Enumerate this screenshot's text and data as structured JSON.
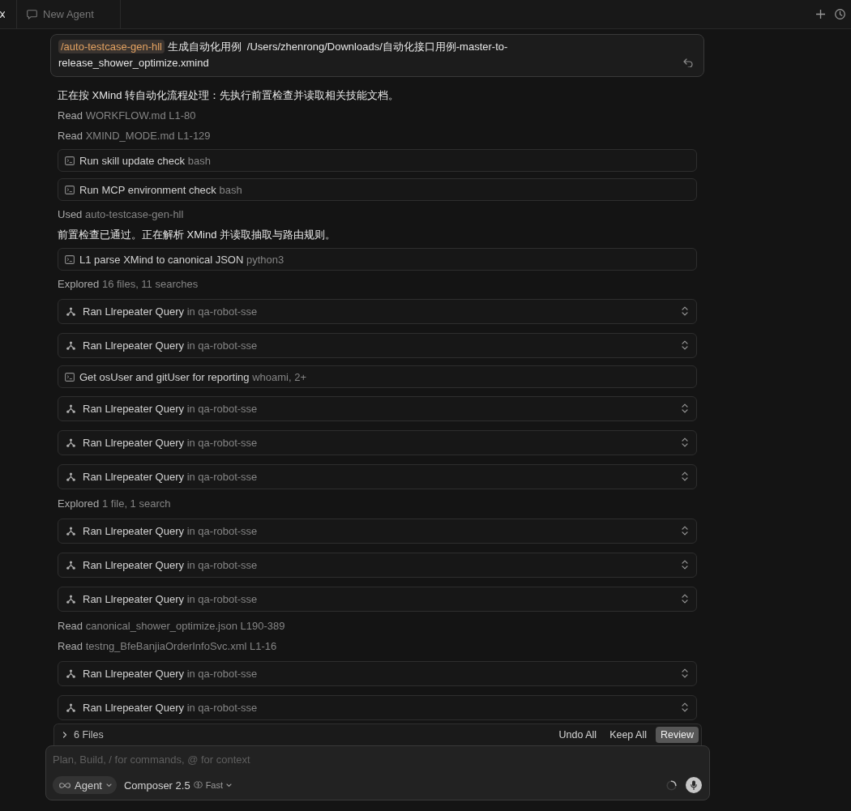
{
  "tab_bar": {
    "tabs": [
      {
        "label": "New Agent",
        "selected": true
      }
    ]
  },
  "user_message": {
    "command": "/auto-testcase-gen-hll",
    "text": "生成自动化用例  /Users/zhenrong/Downloads/自动化接口用例-master-to-release_shower_optimize.xmind"
  },
  "transcript": [
    {
      "kind": "message",
      "text": "正在按 XMind 转自动化流程处理：先执行前置检查并读取相关技能文档。"
    },
    {
      "kind": "action",
      "verb": "Read",
      "detail": "WORKFLOW.md L1-80"
    },
    {
      "kind": "action",
      "verb": "Read",
      "detail": "XMIND_MODE.md L1-129"
    },
    {
      "kind": "command",
      "title": "Run skill update check",
      "detail": "bash"
    },
    {
      "kind": "command",
      "title": "Run MCP environment check",
      "detail": "bash"
    },
    {
      "kind": "action",
      "verb": "Used",
      "detail": "auto-testcase-gen-hll"
    },
    {
      "kind": "message",
      "text": "前置检查已通过。正在解析 XMind 并读取抽取与路由规则。"
    },
    {
      "kind": "command",
      "title": "L1 parse XMind to canonical JSON",
      "detail": "python3"
    },
    {
      "kind": "action",
      "verb": "Explored",
      "detail": "16 files, 11 searches"
    },
    {
      "kind": "tool",
      "verb": "Ran",
      "title": "Llrepeater Query",
      "detail": "in qa-robot-sse"
    },
    {
      "kind": "tool",
      "verb": "Ran",
      "title": "Llrepeater Query",
      "detail": "in qa-robot-sse"
    },
    {
      "kind": "command",
      "title": "Get osUser and gitUser for reporting",
      "detail": "whoami, 2+"
    },
    {
      "kind": "tool",
      "verb": "Ran",
      "title": "Llrepeater Query",
      "detail": "in qa-robot-sse"
    },
    {
      "kind": "tool",
      "verb": "Ran",
      "title": "Llrepeater Query",
      "detail": "in qa-robot-sse"
    },
    {
      "kind": "tool",
      "verb": "Ran",
      "title": "Llrepeater Query",
      "detail": "in qa-robot-sse"
    },
    {
      "kind": "action",
      "verb": "Explored",
      "detail": "1 file, 1 search"
    },
    {
      "kind": "tool",
      "verb": "Ran",
      "title": "Llrepeater Query",
      "detail": "in qa-robot-sse"
    },
    {
      "kind": "tool",
      "verb": "Ran",
      "title": "Llrepeater Query",
      "detail": "in qa-robot-sse"
    },
    {
      "kind": "tool",
      "verb": "Ran",
      "title": "Llrepeater Query",
      "detail": "in qa-robot-sse"
    },
    {
      "kind": "action",
      "verb": "Read",
      "detail": "canonical_shower_optimize.json L190-389"
    },
    {
      "kind": "action",
      "verb": "Read",
      "detail": "testng_BfeBanjiaOrderInfoSvc.xml L1-16"
    },
    {
      "kind": "tool",
      "verb": "Ran",
      "title": "Llrepeater Query",
      "detail": "in qa-robot-sse"
    },
    {
      "kind": "tool",
      "verb": "Ran",
      "title": "Llrepeater Query",
      "detail": "in qa-robot-sse"
    }
  ],
  "changes_bar": {
    "label": "6 Files",
    "expanded": false,
    "buttons": [
      {
        "label": "Undo All",
        "kind": "text"
      },
      {
        "label": "Keep All",
        "kind": "text"
      },
      {
        "label": "Review",
        "kind": "filled"
      }
    ]
  },
  "composer": {
    "placeholder": "Plan, Build, / for commands, @ for context",
    "mode": "Agent",
    "model": "Composer 2.5",
    "speed": "Fast"
  }
}
